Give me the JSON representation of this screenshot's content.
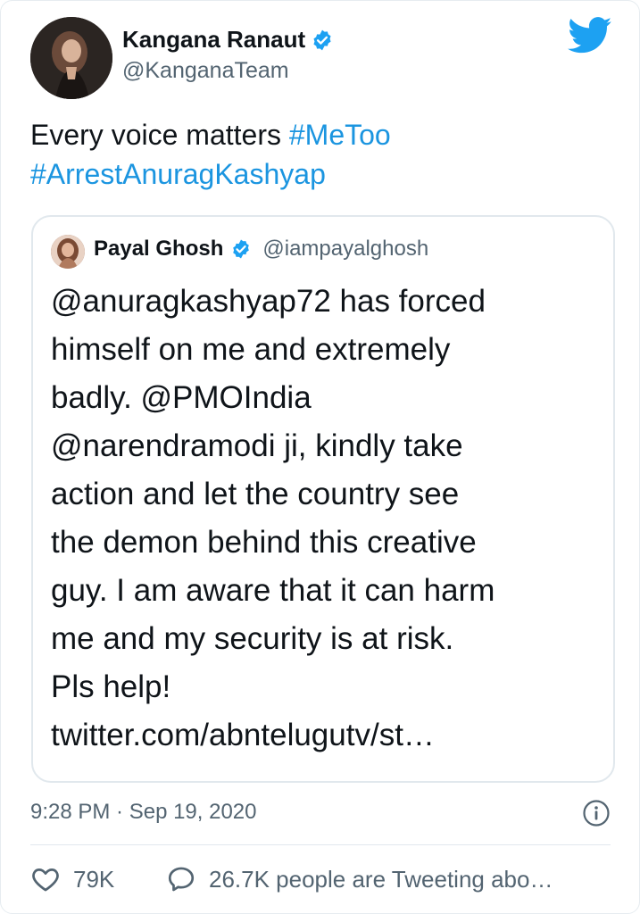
{
  "author": {
    "name": "Kangana Ranaut",
    "handle": "@KanganaTeam",
    "verified": true
  },
  "tweet": {
    "text": "Every voice matters ",
    "hashtags": [
      "#MeToo",
      "#ArrestAnuragKashyap"
    ]
  },
  "quoted_tweet": {
    "name": "Payal Ghosh",
    "handle": "@iampayalghosh",
    "verified": true,
    "lines": [
      "@anuragkashyap72 has forced",
      "himself on me and extremely",
      "badly. @PMOIndia",
      "@narendramodi ji, kindly take",
      "action and let the country see",
      "the demon behind this creative",
      "guy. I am aware that it can harm",
      "me and my security is at risk.",
      "Pls help!",
      "twitter.com/abntelugutv/st…"
    ]
  },
  "timestamp": "9:28 PM · Sep 19, 2020",
  "actions": {
    "likes": "79K",
    "tweeting": "26.7K people are Tweeting abo…"
  },
  "colors": {
    "accent": "#1b95e0",
    "text": "#0f1419",
    "secondary": "#536471",
    "verified": "#1da1f2"
  },
  "icons": [
    "verified-badge-icon",
    "twitter-bird-icon",
    "info-icon",
    "heart-icon",
    "speech-bubble-icon"
  ]
}
